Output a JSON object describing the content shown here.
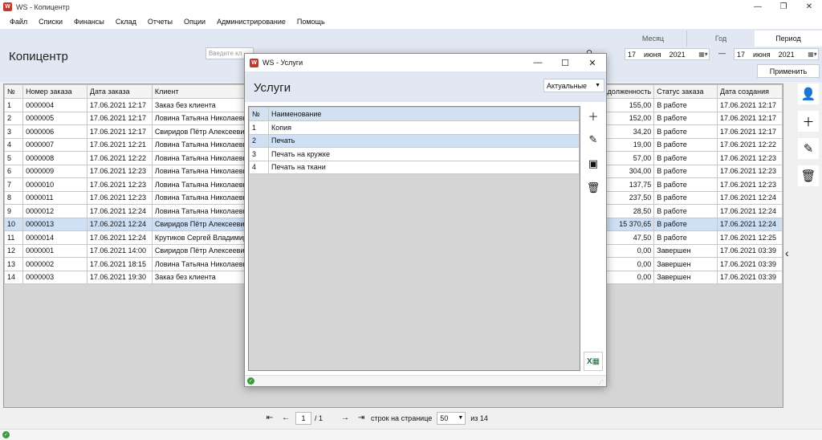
{
  "window": {
    "title": "WS - Копицентр",
    "minimize": "—",
    "maximize": "❐",
    "close": "✕",
    "app_icon": "W"
  },
  "menu": {
    "items": [
      "Файл",
      "Списки",
      "Финансы",
      "Склад",
      "Отчеты",
      "Опции",
      "Администрирование",
      "Помощь"
    ]
  },
  "header": {
    "title": "Копицентр",
    "search_placeholder": "Введите кл",
    "period_tabs": [
      "Месяц",
      "Год",
      "Период"
    ],
    "active_period": "Период",
    "date_from": {
      "day": "17",
      "month": "июня",
      "year": "2021"
    },
    "dash": "—",
    "date_to": {
      "day": "17",
      "month": "июня",
      "year": "2021"
    },
    "apply_label": "Применить"
  },
  "orders": {
    "columns": [
      "№",
      "Номер заказа",
      "Дата заказа",
      "Клиент",
      "Задолженность",
      "Статус заказа",
      "Дата создания"
    ],
    "rows": [
      {
        "n": "1",
        "num": "0000004",
        "date": "17.06.2021 12:17",
        "client": "Заказ без клиента",
        "debt": "155,00",
        "status": "В работе",
        "created": "17.06.2021 12:17"
      },
      {
        "n": "2",
        "num": "0000005",
        "date": "17.06.2021 12:17",
        "client": "Ловина Татьяна Николаевна",
        "debt": "152,00",
        "status": "В работе",
        "created": "17.06.2021 12:17"
      },
      {
        "n": "3",
        "num": "0000006",
        "date": "17.06.2021 12:17",
        "client": "Свиридов Пётр Алексеевич",
        "debt": "34,20",
        "status": "В работе",
        "created": "17.06.2021 12:17"
      },
      {
        "n": "4",
        "num": "0000007",
        "date": "17.06.2021 12:21",
        "client": "Ловина Татьяна Николаевна",
        "debt": "19,00",
        "status": "В работе",
        "created": "17.06.2021 12:22"
      },
      {
        "n": "5",
        "num": "0000008",
        "date": "17.06.2021 12:22",
        "client": "Ловина Татьяна Николаевна",
        "debt": "57,00",
        "status": "В работе",
        "created": "17.06.2021 12:23"
      },
      {
        "n": "6",
        "num": "0000009",
        "date": "17.06.2021 12:23",
        "client": "Ловина Татьяна Николаевна",
        "debt": "304,00",
        "status": "В работе",
        "created": "17.06.2021 12:23"
      },
      {
        "n": "7",
        "num": "0000010",
        "date": "17.06.2021 12:23",
        "client": "Ловина Татьяна Николаевна",
        "debt": "137,75",
        "status": "В работе",
        "created": "17.06.2021 12:23"
      },
      {
        "n": "8",
        "num": "0000011",
        "date": "17.06.2021 12:23",
        "client": "Ловина Татьяна Николаевна",
        "debt": "237,50",
        "status": "В работе",
        "created": "17.06.2021 12:24"
      },
      {
        "n": "9",
        "num": "0000012",
        "date": "17.06.2021 12:24",
        "client": "Ловина Татьяна Николаевна",
        "debt": "28,50",
        "status": "В работе",
        "created": "17.06.2021 12:24"
      },
      {
        "n": "10",
        "num": "0000013",
        "date": "17.06.2021 12:24",
        "client": "Свиридов Пётр Алексеевич",
        "debt": "15 370,65",
        "status": "В работе",
        "created": "17.06.2021 12:24"
      },
      {
        "n": "11",
        "num": "0000014",
        "date": "17.06.2021 12:24",
        "client": "Крутиков Сергей Владимирович",
        "debt": "47,50",
        "status": "В работе",
        "created": "17.06.2021 12:25"
      },
      {
        "n": "12",
        "num": "0000001",
        "date": "17.06.2021 14:00",
        "client": "Свиридов Пётр Алексеевич",
        "debt": "0,00",
        "status": "Завершен",
        "created": "17.06.2021 03:39"
      },
      {
        "n": "13",
        "num": "0000002",
        "date": "17.06.2021 18:15",
        "client": "Ловина Татьяна Николаевна",
        "debt": "0,00",
        "status": "Завершен",
        "created": "17.06.2021 03:39"
      },
      {
        "n": "14",
        "num": "0000003",
        "date": "17.06.2021 19:30",
        "client": "Заказ без клиента",
        "debt": "0,00",
        "status": "Завершен",
        "created": "17.06.2021 03:39"
      }
    ],
    "selected_index": 9
  },
  "side_actions": {
    "icons": [
      "add-client-icon",
      "plus-icon",
      "pencil-icon",
      "trash-icon"
    ]
  },
  "pager": {
    "current_page": "1",
    "total": "/ 1",
    "rows_label": "строк на странице",
    "page_size": "50",
    "count": "из 14"
  },
  "dialog": {
    "title": "WS - Услуги",
    "heading": "Услуги",
    "filter": "Актуальные",
    "columns": [
      "№",
      "Наименование"
    ],
    "rows": [
      {
        "n": "1",
        "name": "Копия"
      },
      {
        "n": "2",
        "name": "Печать"
      },
      {
        "n": "3",
        "name": "Печать на кружке"
      },
      {
        "n": "4",
        "name": "Печать на ткани"
      }
    ],
    "selected_index": 1
  },
  "colors": {
    "header_bg": "#e1e8f3",
    "selection": "#cfe0f5",
    "status_ok": "#3c9a3c",
    "grid_empty": "#d5d5d5"
  }
}
